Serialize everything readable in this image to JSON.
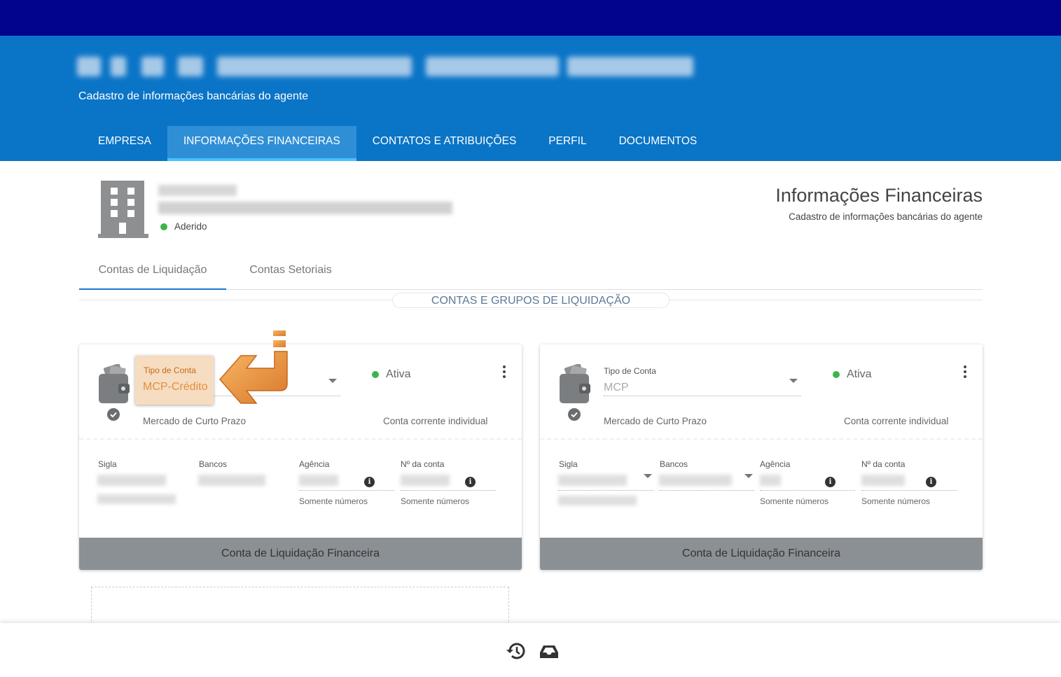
{
  "header": {
    "subtitle": "Cadastro de informações bancárias do agente"
  },
  "nav": {
    "tabs": [
      {
        "label": "EMPRESA"
      },
      {
        "label": "INFORMAÇÕES FINANCEIRAS"
      },
      {
        "label": "CONTATOS E ATRIBUIÇÕES"
      },
      {
        "label": "PERFIL"
      },
      {
        "label": "DOCUMENTOS"
      }
    ],
    "active_index": 1
  },
  "company": {
    "status": "Aderido",
    "status_color": "#3bb54a",
    "icon": "building-icon"
  },
  "page": {
    "title": "Informações Financeiras",
    "subtitle": "Cadastro de informações bancárias do agente"
  },
  "subtabs": [
    {
      "label": "Contas de Liquidação"
    },
    {
      "label": "Contas Setoriais"
    }
  ],
  "section": {
    "title": "CONTAS E GRUPOS DE LIQUIDAÇÃO"
  },
  "cards": [
    {
      "tipo_label": "Tipo de Conta",
      "tipo_value": "MCP-Crédito",
      "status": "Ativa",
      "mercado": "Mercado de Curto Prazo",
      "conta_tipo": "Conta corrente individual",
      "sigla_label": "Sigla",
      "bancos_label": "Bancos",
      "agencia_label": "Agência",
      "conta_label": "Nº da conta",
      "agencia_hint": "Somente números",
      "conta_hint": "Somente números",
      "footer": "Conta de Liquidação Financeira",
      "highlighted": true
    },
    {
      "tipo_label": "Tipo de Conta",
      "tipo_value": "MCP",
      "status": "Ativa",
      "mercado": "Mercado de Curto Prazo",
      "conta_tipo": "Conta corrente individual",
      "sigla_label": "Sigla",
      "bancos_label": "Bancos",
      "agencia_label": "Agência",
      "conta_label": "Nº da conta",
      "agencia_hint": "Somente números",
      "conta_hint": "Somente números",
      "footer": "Conta de Liquidação Financeira",
      "highlighted": false
    }
  ],
  "info_glyph": "i",
  "colors": {
    "topbar": "#03048e",
    "header": "#0a74c6",
    "active_tab_underline": "#48c1ff",
    "status_green": "#3bb54a",
    "highlight": "#f6dcc0",
    "arrow": "#f0a050",
    "card_footer": "#8b9095"
  },
  "footer_icons": [
    "history-icon",
    "inbox-icon"
  ]
}
